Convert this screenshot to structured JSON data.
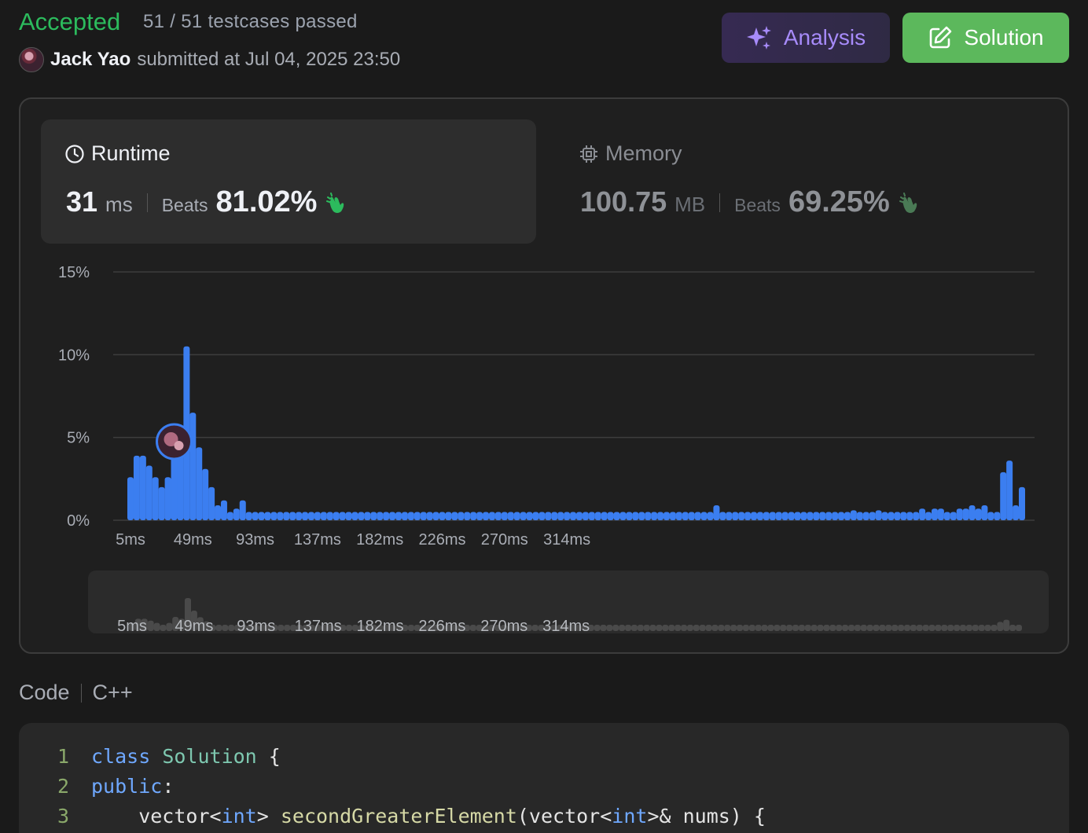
{
  "header": {
    "status": "Accepted",
    "testcases": "51 / 51 testcases passed",
    "user_name": "Jack Yao",
    "submitted_text": "submitted at Jul 04, 2025 23:50",
    "analysis_label": "Analysis",
    "solution_label": "Solution"
  },
  "runtime": {
    "label": "Runtime",
    "value": "31",
    "unit": "ms",
    "beats_label": "Beats",
    "beats": "81.02%"
  },
  "memory": {
    "label": "Memory",
    "value": "100.75",
    "unit": "MB",
    "beats_label": "Beats",
    "beats": "69.25%"
  },
  "chart_data": {
    "type": "bar",
    "y_ticks": [
      "15%",
      "10%",
      "5%",
      "0%"
    ],
    "y_tick_values": [
      15,
      10,
      5,
      0
    ],
    "ylim": [
      0,
      15
    ],
    "x_tick_labels": [
      "5ms",
      "49ms",
      "93ms",
      "137ms",
      "182ms",
      "226ms",
      "270ms",
      "314ms"
    ],
    "values": [
      2.6,
      3.9,
      3.9,
      3.3,
      2.6,
      2.0,
      2.6,
      4.5,
      3.9,
      10.5,
      6.5,
      4.4,
      3.1,
      2.0,
      0.9,
      1.2,
      0.5,
      0.7,
      1.2,
      0.5,
      0.5,
      0.5,
      0.5,
      0.5,
      0.5,
      0.5,
      0.5,
      0.5,
      0.5,
      0.5,
      0.5,
      0.5,
      0.5,
      0.5,
      0.5,
      0.5,
      0.5,
      0.5,
      0.5,
      0.5,
      0.5,
      0.5,
      0.5,
      0.5,
      0.5,
      0.5,
      0.5,
      0.5,
      0.5,
      0.5,
      0.5,
      0.5,
      0.5,
      0.5,
      0.5,
      0.5,
      0.5,
      0.5,
      0.5,
      0.5,
      0.5,
      0.5,
      0.5,
      0.5,
      0.5,
      0.5,
      0.5,
      0.5,
      0.5,
      0.5,
      0.5,
      0.5,
      0.5,
      0.5,
      0.5,
      0.5,
      0.5,
      0.5,
      0.5,
      0.5,
      0.5,
      0.5,
      0.5,
      0.5,
      0.5,
      0.5,
      0.5,
      0.5,
      0.5,
      0.5,
      0.5,
      0.5,
      0.5,
      0.5,
      0.9,
      0.5,
      0.5,
      0.5,
      0.5,
      0.5,
      0.5,
      0.5,
      0.5,
      0.5,
      0.5,
      0.5,
      0.5,
      0.5,
      0.5,
      0.5,
      0.5,
      0.5,
      0.5,
      0.5,
      0.5,
      0.5,
      0.6,
      0.5,
      0.5,
      0.5,
      0.6,
      0.5,
      0.5,
      0.5,
      0.5,
      0.5,
      0.5,
      0.7,
      0.5,
      0.7,
      0.7,
      0.5,
      0.5,
      0.7,
      0.7,
      0.9,
      0.7,
      0.9,
      0.5,
      0.5,
      2.9,
      3.6,
      0.9,
      2.0
    ],
    "user_bar_index": 7,
    "bar_color": "#3b7ef0",
    "grid": true
  },
  "code": {
    "label": "Code",
    "language": "C++",
    "lines": [
      {
        "num": "1",
        "segments": [
          [
            "kw",
            "class"
          ],
          [
            "pl",
            " "
          ],
          [
            "cls",
            "Solution"
          ],
          [
            "pl",
            " {"
          ]
        ]
      },
      {
        "num": "2",
        "segments": [
          [
            "kw",
            "public"
          ],
          [
            "pl",
            ":"
          ]
        ]
      },
      {
        "num": "3",
        "segments": [
          [
            "pl",
            "    vector<"
          ],
          [
            "kw",
            "int"
          ],
          [
            "pl",
            "> "
          ],
          [
            "fn",
            "secondGreaterElement"
          ],
          [
            "pl",
            "(vector<"
          ],
          [
            "kw",
            "int"
          ],
          [
            "pl",
            ">& nums) {"
          ]
        ]
      }
    ]
  }
}
